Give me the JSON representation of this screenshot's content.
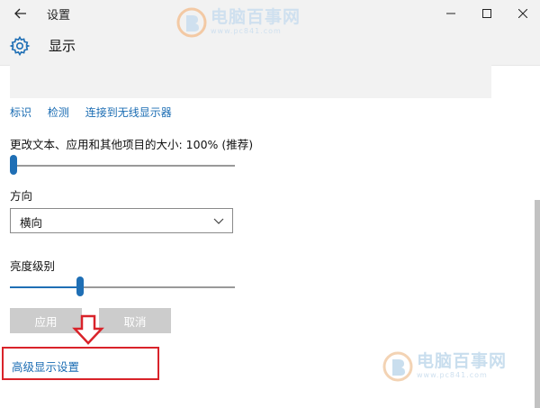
{
  "window": {
    "title": "设置",
    "back_icon": "back-arrow-icon",
    "minimize_icon": "minimize-icon",
    "maximize_icon": "maximize-icon",
    "close_icon": "close-icon"
  },
  "header": {
    "icon": "gear-icon",
    "title": "显示"
  },
  "links": {
    "identify": "标识",
    "detect": "检测",
    "wireless": "连接到无线显示器"
  },
  "scale": {
    "label": "更改文本、应用和其他项目的大小: 100% (推荐)",
    "level": 0
  },
  "orientation": {
    "label": "方向",
    "value": "横向",
    "chevron_icon": "chevron-down-icon"
  },
  "brightness": {
    "label": "亮度级别",
    "level": 0.31
  },
  "buttons": {
    "apply": "应用",
    "cancel": "取消"
  },
  "advanced": {
    "link": "高级显示设置"
  },
  "watermark": {
    "brand": "电脑百事网",
    "url": "www.pc841.com"
  },
  "colors": {
    "accent": "#1f6fb5",
    "link": "#1a6cb3",
    "highlight": "#d9232a",
    "disabled_button": "#cccccc"
  }
}
